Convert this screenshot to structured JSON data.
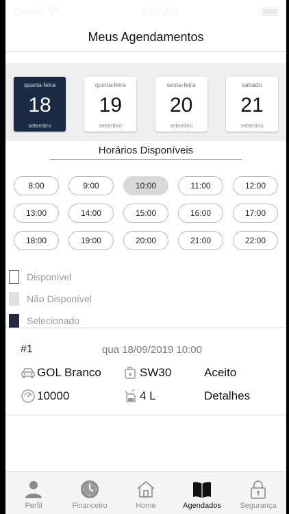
{
  "status_bar": {
    "carrier": "Carrier",
    "time": "6:39 AM"
  },
  "header": {
    "title": "Meus Agendamentos"
  },
  "days": [
    {
      "weekday": "quarta-feira",
      "day": "18",
      "month": "setembro",
      "selected": true
    },
    {
      "weekday": "quinta-feira",
      "day": "19",
      "month": "setembro",
      "selected": false
    },
    {
      "weekday": "sexta-feira",
      "day": "20",
      "month": "setembro",
      "selected": false
    },
    {
      "weekday": "sábado",
      "day": "21",
      "month": "setembro",
      "selected": false
    }
  ],
  "slots_section": {
    "title": "Horários Disponíveis",
    "slots": [
      {
        "time": "8:00",
        "status": "available"
      },
      {
        "time": "9:00",
        "status": "available"
      },
      {
        "time": "10:00",
        "status": "unavailable"
      },
      {
        "time": "11:00",
        "status": "available"
      },
      {
        "time": "12:00",
        "status": "available"
      },
      {
        "time": "13:00",
        "status": "available"
      },
      {
        "time": "14:00",
        "status": "available"
      },
      {
        "time": "15:00",
        "status": "available"
      },
      {
        "time": "16:00",
        "status": "available"
      },
      {
        "time": "17:00",
        "status": "available"
      },
      {
        "time": "18:00",
        "status": "available"
      },
      {
        "time": "19:00",
        "status": "available"
      },
      {
        "time": "20:00",
        "status": "available"
      },
      {
        "time": "21:00",
        "status": "available"
      },
      {
        "time": "22:00",
        "status": "available"
      }
    ]
  },
  "legend": {
    "available": "Disponível",
    "unavailable": "Não Disponível",
    "selected": "Selecionado"
  },
  "appointment": {
    "id": "#1",
    "datetime": "qua 18/09/2019 10:00",
    "car": "GOL Branco",
    "oil": "SW30",
    "status": "Aceito",
    "mileage": "10000",
    "quantity": "4 L",
    "details": "Detalhes",
    "icons": [
      "car-icon",
      "oil-can-icon",
      "odometer-icon",
      "oil-bottle-icon"
    ]
  },
  "tabbar": {
    "active": "agendados",
    "tabs": [
      {
        "key": "perfil",
        "label": "Perfil",
        "icon": "person-icon"
      },
      {
        "key": "financeiro",
        "label": "Financeiro",
        "icon": "clock-icon"
      },
      {
        "key": "home",
        "label": "Home",
        "icon": "house-icon"
      },
      {
        "key": "agendados",
        "label": "Agendados",
        "icon": "book-icon"
      },
      {
        "key": "seguranca",
        "label": "Segurança",
        "icon": "lock-icon"
      }
    ]
  },
  "colors": {
    "selected_day_bg": "#1a2a44",
    "unavailable_slot": "#d9d9d9",
    "legend_selected": "#232a3e"
  }
}
